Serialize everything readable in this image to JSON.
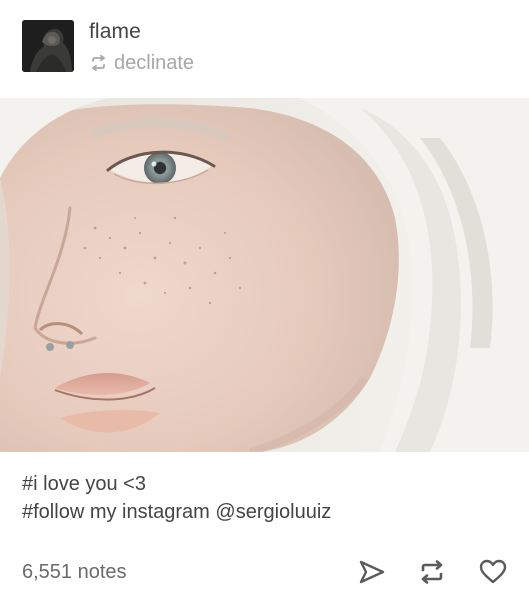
{
  "post": {
    "blog_name": "flame",
    "reblog_source": "declinate",
    "icons": {
      "avatar": "avatar-image",
      "reblog_small": "reblog-icon",
      "share": "share-icon",
      "reblog": "reblog-icon",
      "like": "heart-icon"
    },
    "caption": {
      "line1": "#i love you <3",
      "line2": "#follow my instagram @sergioluuiz"
    },
    "footer": {
      "notes": "6,551 notes"
    },
    "colors": {
      "text": "#444444",
      "muted": "#a7a7a7",
      "icon": "#5a5a5a"
    }
  }
}
